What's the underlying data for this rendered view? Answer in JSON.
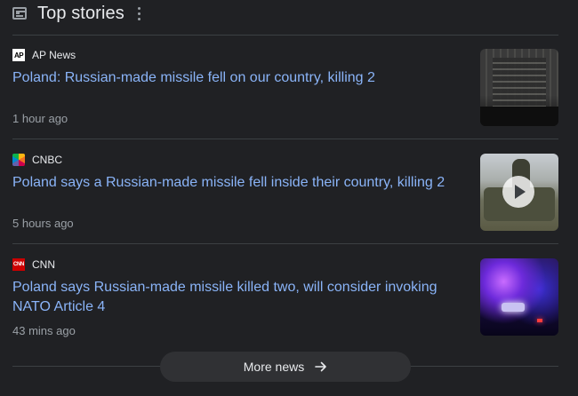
{
  "header": {
    "title": "Top stories"
  },
  "stories": [
    {
      "source": "AP News",
      "favicon": "AP",
      "headline": "Poland: Russian-made missile fell on our country, killing 2",
      "time": "1 hour ago"
    },
    {
      "source": "CNBC",
      "favicon": "",
      "headline": "Poland says a Russian-made missile fell inside their country, killing 2",
      "time": "5 hours ago"
    },
    {
      "source": "CNN",
      "favicon": "CNN",
      "headline": "Poland says Russian-made missile killed two, will consider invoking NATO Article 4",
      "time": "43 mins ago"
    }
  ],
  "more_button": {
    "label": "More news"
  },
  "colors": {
    "background": "#202124",
    "link": "#8ab4f8",
    "muted": "#9aa0a6",
    "text": "#e8eaed",
    "button": "#303134"
  }
}
